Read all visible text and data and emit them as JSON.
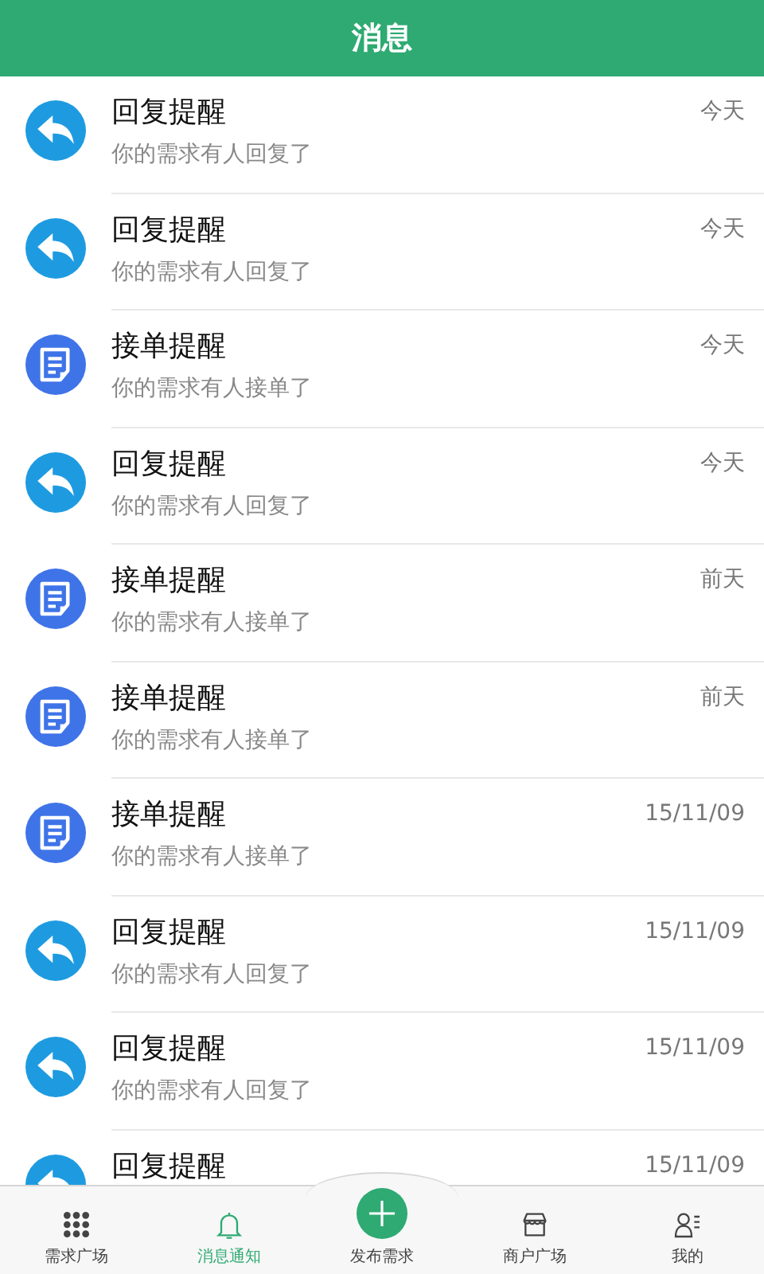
{
  "header": {
    "title": "消息"
  },
  "messages": [
    {
      "kind": "reply",
      "title": "回复提醒",
      "subtitle": "你的需求有人回复了",
      "time": "今天"
    },
    {
      "kind": "reply",
      "title": "回复提醒",
      "subtitle": "你的需求有人回复了",
      "time": "今天"
    },
    {
      "kind": "order",
      "title": "接单提醒",
      "subtitle": "你的需求有人接单了",
      "time": "今天"
    },
    {
      "kind": "reply",
      "title": "回复提醒",
      "subtitle": "你的需求有人回复了",
      "time": "今天"
    },
    {
      "kind": "order",
      "title": "接单提醒",
      "subtitle": "你的需求有人接单了",
      "time": "前天"
    },
    {
      "kind": "order",
      "title": "接单提醒",
      "subtitle": "你的需求有人接单了",
      "time": "前天"
    },
    {
      "kind": "order",
      "title": "接单提醒",
      "subtitle": "你的需求有人接单了",
      "time": "15/11/09"
    },
    {
      "kind": "reply",
      "title": "回复提醒",
      "subtitle": "你的需求有人回复了",
      "time": "15/11/09"
    },
    {
      "kind": "reply",
      "title": "回复提醒",
      "subtitle": "你的需求有人回复了",
      "time": "15/11/09"
    },
    {
      "kind": "reply",
      "title": "回复提醒",
      "time": "15/11/09"
    }
  ],
  "tab_bar": [
    {
      "kind": "grid",
      "label": "需求广场",
      "selected": false
    },
    {
      "kind": "bell",
      "label": "消息通知",
      "selected": true
    },
    {
      "kind": "plus",
      "label": "发布需求",
      "selected": false
    },
    {
      "kind": "shop",
      "label": "商户广场",
      "selected": false
    },
    {
      "kind": "user",
      "label": "我的",
      "selected": false
    }
  ]
}
